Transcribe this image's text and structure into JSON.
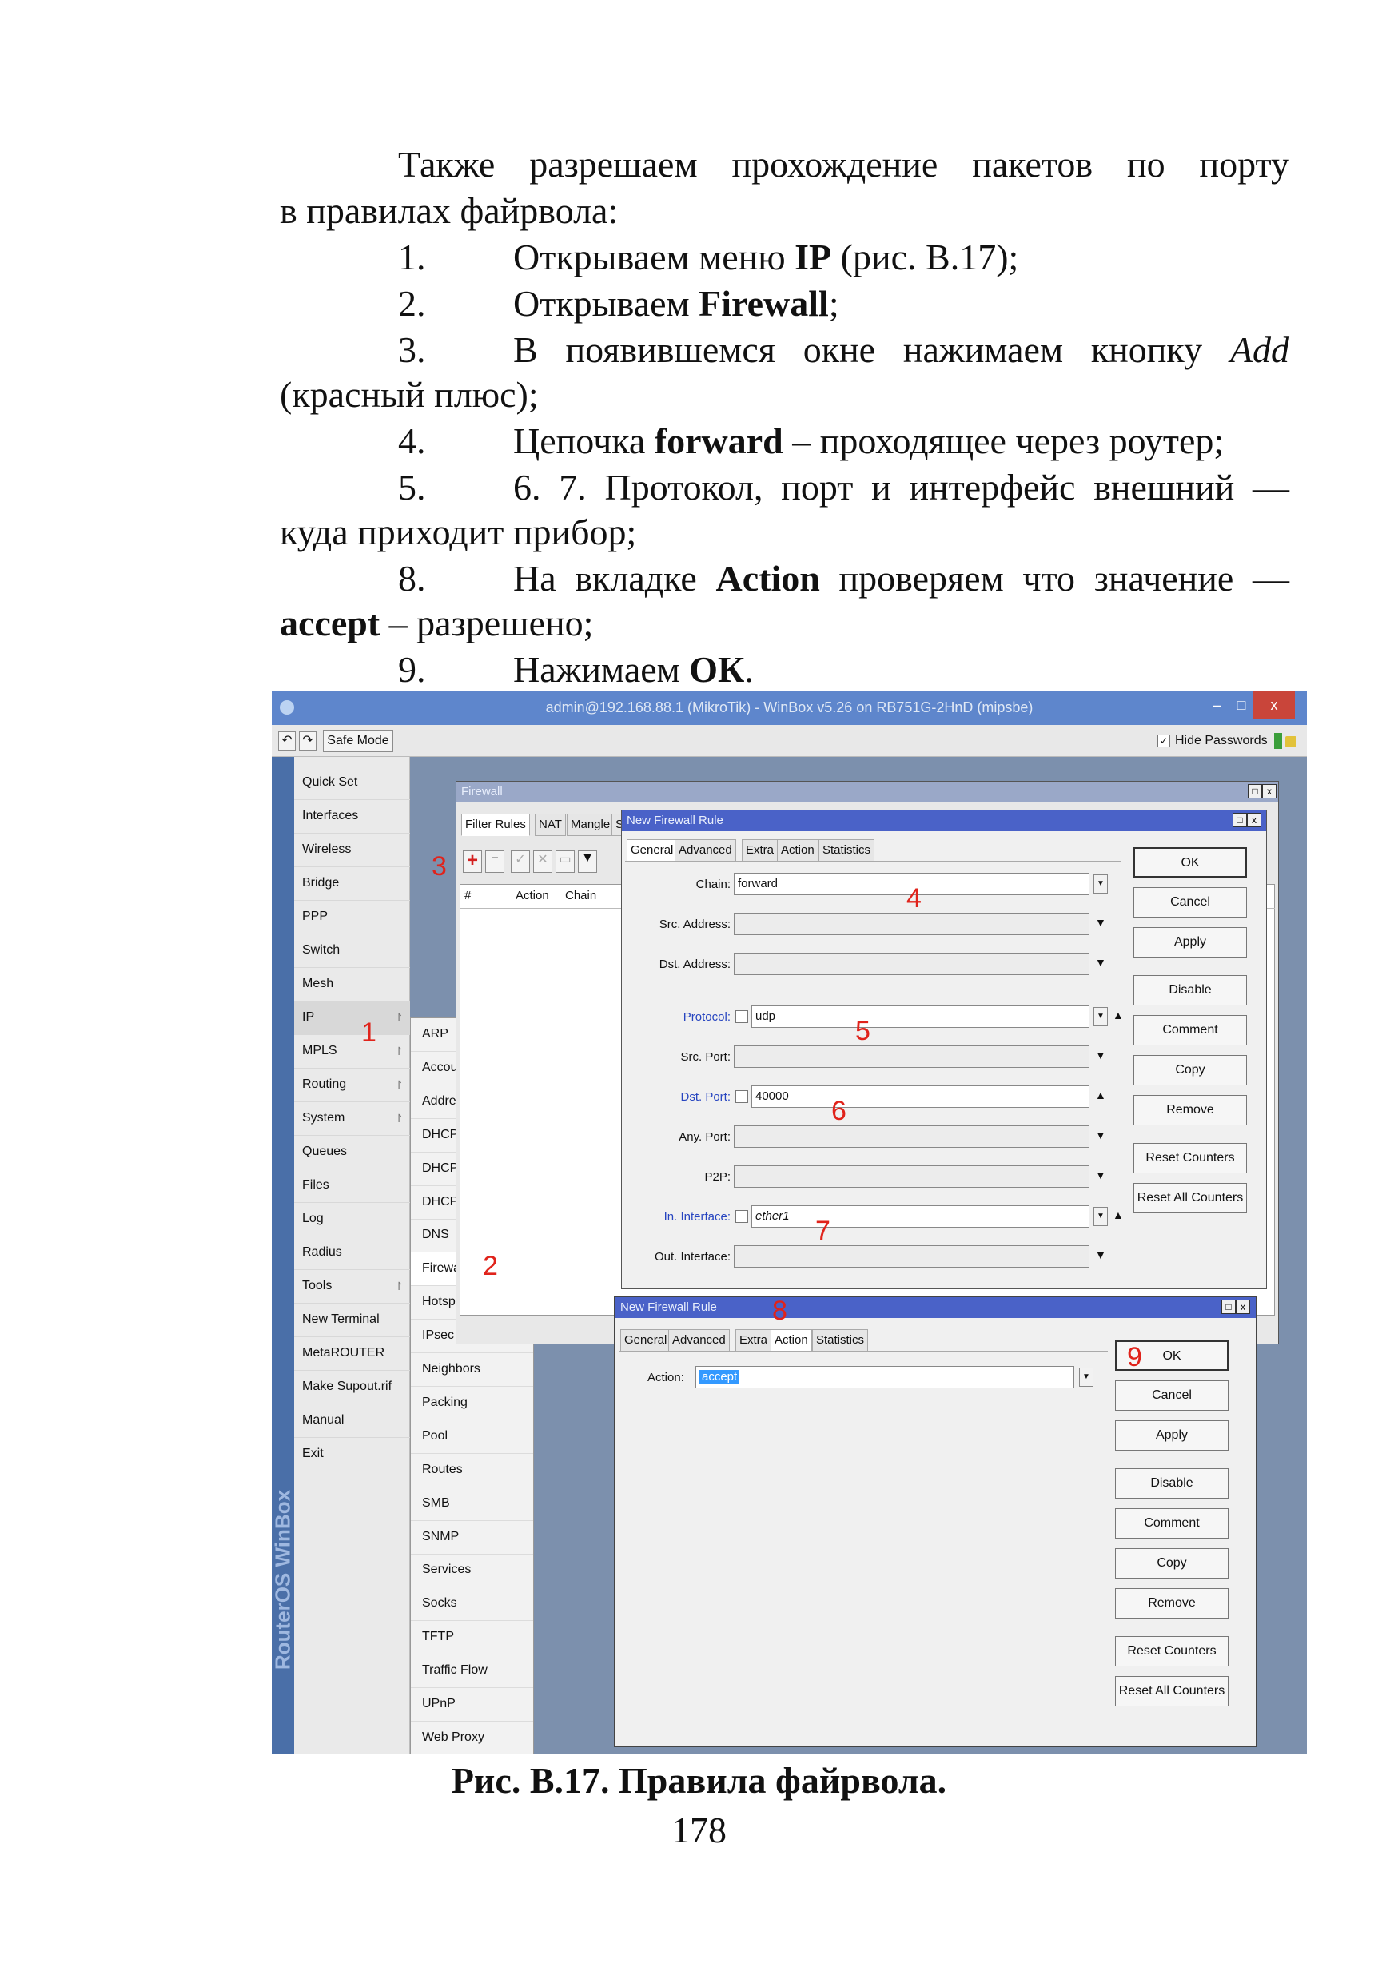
{
  "doc": {
    "para1_line1": "Также разрешаем прохождение пакетов по порту",
    "para1_line2": "в правилах файрвола:",
    "step1": {
      "n": "1.",
      "t1": "Открываем меню ",
      "b": "IP",
      "t2": " (рис. В.17);"
    },
    "step2": {
      "n": "2.",
      "t1": "Открываем ",
      "b": "Firewall",
      "t2": ";"
    },
    "step3": {
      "n": "3.",
      "t1": "В появившемся окне нажимаем кнопку ",
      "i": "Add",
      "line2": "(красный плюс);"
    },
    "step4": {
      "n": "4.",
      "t1": "Цепочка ",
      "b": "forward",
      "t2": " – проходящее через роутер;"
    },
    "step5": {
      "n": "5.",
      "t1": "6. 7. Протокол, порт и интерфейс внешний —",
      "line2": "куда приходит прибор;"
    },
    "step8": {
      "n": "8.",
      "t1": "На вкладке ",
      "b": "Action",
      "t2": " проверяем что значение —",
      "b2": "accept",
      "t3": " – разрешено;"
    },
    "step9": {
      "n": "9.",
      "t1": "Нажимаем ",
      "b": "ОК",
      "t2": "."
    },
    "caption": "Рис. В.17. Правила файрвола.",
    "page_number": "178"
  },
  "winbox": {
    "title": "admin@192.168.88.1 (MikroTik) - WinBox v5.26 on RB751G-2HnD (mipsbe)",
    "min_label": "–",
    "max_label": "□",
    "close_label": "x",
    "safe_mode": "Safe Mode",
    "hide_passwords": "Hide Passwords",
    "side_brand": "RouterOS WinBox",
    "menu": [
      "Quick Set",
      "Interfaces",
      "Wireless",
      "Bridge",
      "PPP",
      "Switch",
      "Mesh",
      "IP",
      "MPLS",
      "Routing",
      "System",
      "Queues",
      "Files",
      "Log",
      "Radius",
      "Tools",
      "New Terminal",
      "MetaROUTER",
      "Make Supout.rif",
      "Manual",
      "Exit"
    ],
    "submenu": [
      "ARP",
      "Accounting",
      "Addresses",
      "DHCP Client",
      "DHCP Relay",
      "DHCP Server",
      "DNS",
      "Firewall",
      "Hotspot",
      "IPsec",
      "Neighbors",
      "Packing",
      "Pool",
      "Routes",
      "SMB",
      "SNMP",
      "Services",
      "Socks",
      "TFTP",
      "Traffic Flow",
      "UPnP",
      "Web Proxy"
    ],
    "firewall": {
      "title": "Firewall",
      "tabs": [
        "Filter Rules",
        "NAT",
        "Mangle",
        "Se"
      ],
      "col_hash": "#",
      "col_action": "Action",
      "col_chain": "Chain"
    },
    "rule1": {
      "title": "New Firewall Rule",
      "tabs": [
        "General",
        "Advanced",
        "Extra",
        "Action",
        "Statistics"
      ],
      "labels": {
        "chain": "Chain:",
        "src_address": "Src. Address:",
        "dst_address": "Dst. Address:",
        "protocol": "Protocol:",
        "src_port": "Src. Port:",
        "dst_port": "Dst. Port:",
        "any_port": "Any. Port:",
        "p2p": "P2P:",
        "in_interface": "In. Interface:",
        "out_interface": "Out. Interface:"
      },
      "values": {
        "chain": "forward",
        "protocol": "udp",
        "dst_port": "40000",
        "in_interface": "ether1"
      },
      "buttons": [
        "OK",
        "Cancel",
        "Apply",
        "Disable",
        "Comment",
        "Copy",
        "Remove",
        "Reset Counters",
        "Reset All Counters"
      ]
    },
    "rule2": {
      "title": "New Firewall Rule",
      "tabs": [
        "General",
        "Advanced",
        "Extra",
        "Action",
        "Statistics"
      ],
      "action_label": "Action:",
      "action_value": "accept",
      "buttons": [
        "OK",
        "Cancel",
        "Apply",
        "Disable",
        "Comment",
        "Copy",
        "Remove",
        "Reset Counters",
        "Reset All Counters"
      ]
    },
    "markers": [
      "1",
      "2",
      "3",
      "4",
      "5",
      "6",
      "7",
      "8",
      "9"
    ],
    "colors": {
      "titlebar": "#5e86cc",
      "dialog_title": "#4a62c8",
      "marker": "#e0231b",
      "selection": "#3399ff"
    }
  }
}
